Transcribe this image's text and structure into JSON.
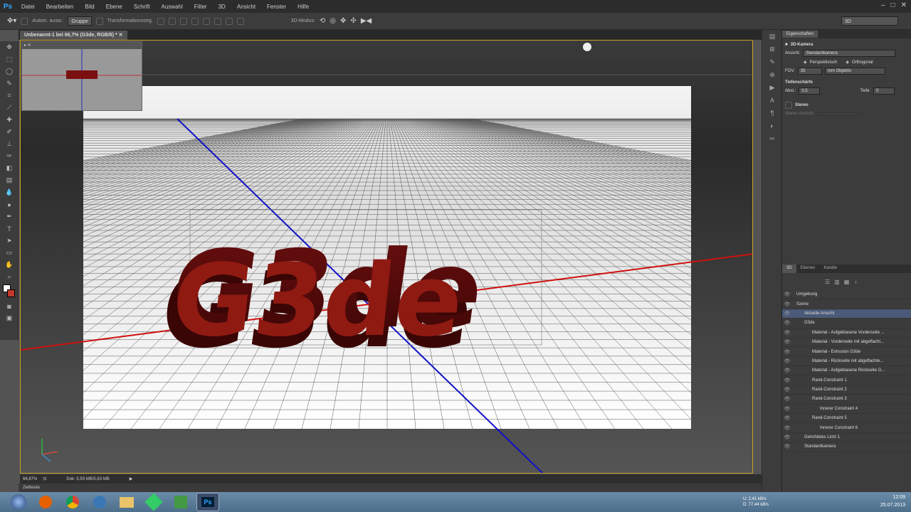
{
  "menu": {
    "items": [
      "Datei",
      "Bearbeiten",
      "Bild",
      "Ebene",
      "Schrift",
      "Auswahl",
      "Filter",
      "3D",
      "Ansicht",
      "Fenster",
      "Hilfe"
    ]
  },
  "options": {
    "autoselect": "Autom. ausw.:",
    "group": "Gruppe",
    "transform": "Transformationsstrg.",
    "mode3d": "3D-Modus:",
    "workspace": "3D"
  },
  "document": {
    "tab_title": "Unbenannt-1 bei 66,7% (G3de, RGB/8) *",
    "text3d": "G3de",
    "zoom": "66,67%",
    "doc_size": "Dok: 5,93 MB/5,63 MB"
  },
  "timeline_label": "Zeitleiste",
  "properties": {
    "tab": "Eigenschaften",
    "title": "3D-Kamera",
    "view_label": "Ansicht:",
    "view_value": "Standardkamera",
    "persp": "Perspektivisch",
    "ortho": "Orthogonal",
    "fov_label": "FOV:",
    "fov_value": "35",
    "fov_unit": "mm Objektiv",
    "dof_label": "Tiefenschärfe",
    "dist_label": "Abst.:",
    "dist_value": "0,5",
    "depth_label": "Tiefe:",
    "depth_value": "0",
    "stereo_label": "Stereo",
    "stereo_view": "Stereo-Ansicht:"
  },
  "panel3d": {
    "tabs": [
      "3D",
      "Ebenen",
      "Kanäle"
    ],
    "rows": [
      {
        "label": "Umgebung",
        "indent": 0
      },
      {
        "label": "Szene",
        "indent": 0
      },
      {
        "label": "Aktuelle Ansicht",
        "indent": 1
      },
      {
        "label": "G3de",
        "indent": 1
      },
      {
        "label": "Material - Aufgeblasene Vorderseite ...",
        "indent": 2
      },
      {
        "label": "Material - Vorderseite mit abgeflacht...",
        "indent": 2
      },
      {
        "label": "Material - Extrusion G3de",
        "indent": 2
      },
      {
        "label": "Material - Rückseite mit abgeflachte...",
        "indent": 2
      },
      {
        "label": "Material - Aufgeblasene Rückseite G...",
        "indent": 2
      },
      {
        "label": "Rand-Constraint 1",
        "indent": 2
      },
      {
        "label": "Rand-Constraint 2",
        "indent": 2
      },
      {
        "label": "Rand-Constraint 3",
        "indent": 2
      },
      {
        "label": "Innerer Constraint 4",
        "indent": 3
      },
      {
        "label": "Rand-Constraint 5",
        "indent": 2
      },
      {
        "label": "Innerer Constraint 6",
        "indent": 3
      },
      {
        "label": "Gerichtetes Licht 1",
        "indent": 1
      },
      {
        "label": "Standardkamera",
        "indent": 1
      }
    ]
  },
  "taskbar": {
    "time": "12:09",
    "date": "25.07.2013",
    "upload": "2,41 kB/s",
    "download": "77,44 kB/s",
    "u_label": "U:",
    "d_label": "D:"
  }
}
